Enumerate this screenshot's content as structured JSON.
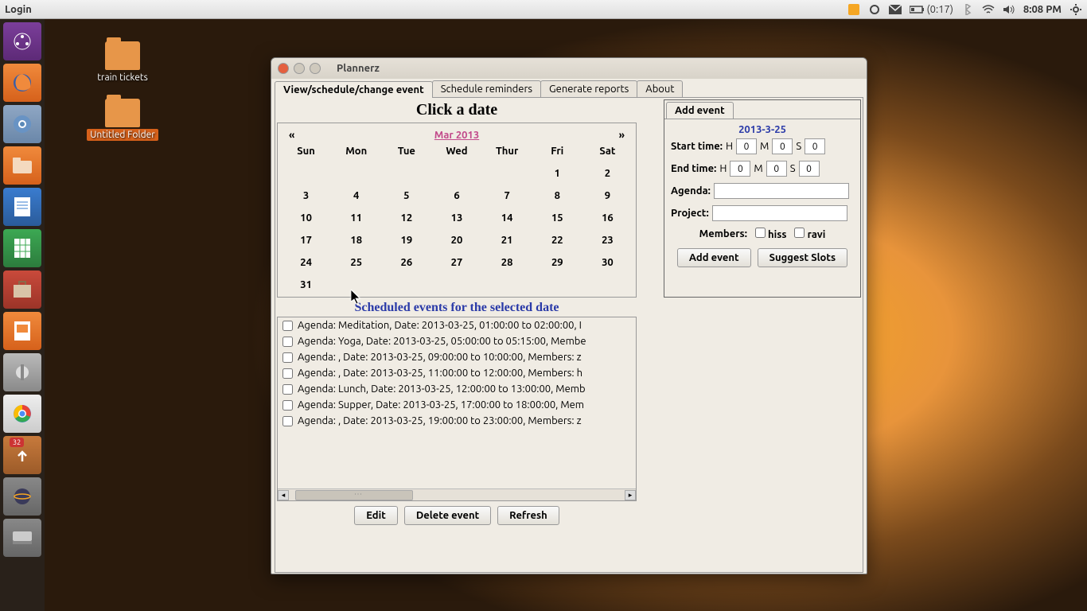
{
  "menubar": {
    "left": "Login",
    "battery": "(0:17)",
    "clock": "8:08 PM"
  },
  "desktop": {
    "icon1": "train tickets",
    "icon2": "Untitled Folder"
  },
  "launcher": {
    "updates_badge": "32"
  },
  "window": {
    "title": "Plannerz",
    "tabs": {
      "t1": "View/schedule/change event",
      "t2": "Schedule reminders",
      "t3": "Generate reports",
      "t4": "About"
    },
    "cal": {
      "header": "Click a date",
      "prev": "«",
      "next": "»",
      "month": "Mar 2013",
      "dow": {
        "d0": "Sun",
        "d1": "Mon",
        "d2": "Tue",
        "d3": "Wed",
        "d4": "Thur",
        "d5": "Fri",
        "d6": "Sat"
      },
      "days": {
        "c1": "1",
        "c2": "2",
        "c3": "3",
        "c4": "4",
        "c5": "5",
        "c6": "6",
        "c7": "7",
        "c8": "8",
        "c9": "9",
        "c10": "10",
        "c11": "11",
        "c12": "12",
        "c13": "13",
        "c14": "14",
        "c15": "15",
        "c16": "16",
        "c17": "17",
        "c18": "18",
        "c19": "19",
        "c20": "20",
        "c21": "21",
        "c22": "22",
        "c23": "23",
        "c24": "24",
        "c25": "25",
        "c26": "26",
        "c27": "27",
        "c28": "28",
        "c29": "29",
        "c30": "30",
        "c31": "31"
      }
    },
    "side": {
      "tab": "Add event",
      "date": "2013-3-25",
      "start_label": "Start time:",
      "end_label": "End time:",
      "H": "H",
      "M": "M",
      "S": "S",
      "start_h": "0",
      "start_m": "0",
      "start_s": "0",
      "end_h": "0",
      "end_m": "0",
      "end_s": "0",
      "agenda_label": "Agenda:",
      "project_label": "Project:",
      "members_label": "Members:",
      "member1": "hiss",
      "member2": "ravi",
      "btn_add": "Add event",
      "btn_suggest": "Suggest Slots"
    },
    "events": {
      "title": "Scheduled events for the selected date",
      "rows": {
        "r0": "Agenda: Meditation, Date: 2013-03-25, 01:00:00 to 02:00:00, I",
        "r1": "Agenda: Yoga, Date: 2013-03-25, 05:00:00 to 05:15:00, Membe",
        "r2": "Agenda: , Date: 2013-03-25, 09:00:00 to 10:00:00, Members: z",
        "r3": "Agenda: , Date: 2013-03-25, 11:00:00 to 12:00:00, Members: h",
        "r4": "Agenda: Lunch, Date: 2013-03-25, 12:00:00 to 13:00:00, Memb",
        "r5": "Agenda: Supper, Date: 2013-03-25, 17:00:00 to 18:00:00, Mem",
        "r6": "Agenda: , Date: 2013-03-25, 19:00:00 to 23:00:00, Members: z"
      },
      "btn_edit": "Edit",
      "btn_delete": "Delete event",
      "btn_refresh": "Refresh"
    }
  }
}
